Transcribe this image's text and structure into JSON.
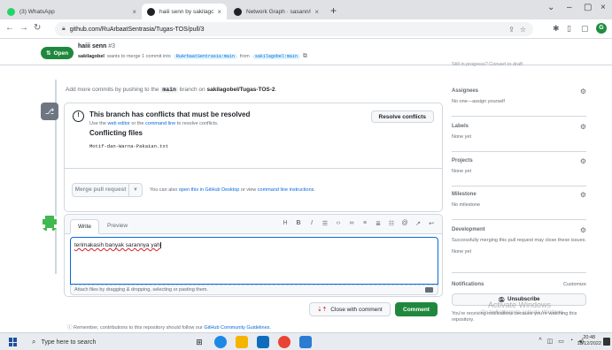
{
  "browser": {
    "tabs": [
      {
        "title": "(3) WhatsApp",
        "active": false,
        "icon_color": "#25d366"
      },
      {
        "title": "haiii senn by sakilagobel · Pull Re",
        "active": true,
        "icon_color": "#1f2328"
      },
      {
        "title": "Network Graph · sasann/Perubah",
        "active": false,
        "icon_color": "#1f2328"
      }
    ],
    "new_tab": "+",
    "url": "github.com/RuArbaatSentrasia/Tugas-TOS/pull/3",
    "profile_initial": "G"
  },
  "pr": {
    "state_label": "Open",
    "title": "haiii senn",
    "number": "#3",
    "author": "sakilagobel",
    "wants_text": "wants to merge 1 commit into",
    "base_branch": "RuArbaatSentrasia:main",
    "from_text": "from",
    "head_branch": "sakilagobel:main"
  },
  "timeline": {
    "add_commits_prefix": "Add more commits by pushing to the",
    "add_commits_branch": "main",
    "add_commits_mid": "branch on",
    "add_commits_repo": "sakilagobel/Tugas-TOS-2",
    "add_commits_suffix": "."
  },
  "merge": {
    "conflict_title": "This branch has conflicts that must be resolved",
    "conflict_desc_prefix": "Use the",
    "web_editor_link": "web editor",
    "conflict_desc_or": "or the",
    "command_line_link": "command line",
    "conflict_desc_suffix": "to resolve conflicts.",
    "conflicting_files_label": "Conflicting files",
    "conflicting_file": "Motif-dan-Warna-Pakaian.txt",
    "resolve_button": "Resolve conflicts",
    "merge_button": "Merge pull request",
    "merge_note_prefix": "You can also",
    "desktop_link": "open this in GitHub Desktop",
    "merge_note_mid": "or view",
    "instructions_link": "command line instructions",
    "merge_note_suffix": "."
  },
  "comment": {
    "tab_write": "Write",
    "tab_preview": "Preview",
    "toolbar": [
      "H",
      "B",
      "I",
      "quote",
      "code",
      "link",
      "bullets",
      "numbers",
      "tasks",
      "mention",
      "reference",
      "undo"
    ],
    "text": "terimakasih banyak sarannya yah",
    "attach_text": "Attach files by dragging & dropping, selecting or pasting them.",
    "close_button": "Close with comment",
    "comment_button": "Comment",
    "remember_prefix": "Remember, contributions to this repository should follow our",
    "guidelines_link": "GitHub Community Guidelines",
    "remember_suffix": "."
  },
  "sidebar": {
    "top_fade": "Still in progress? Convert to draft",
    "assignees": {
      "label": "Assignees",
      "value": "No one—assign yourself"
    },
    "labels": {
      "label": "Labels",
      "value": "None yet"
    },
    "projects": {
      "label": "Projects",
      "value": "None yet"
    },
    "milestone": {
      "label": "Milestone",
      "value": "No milestone"
    },
    "development": {
      "label": "Development",
      "value": "Successfully merging this pull request may close these issues.",
      "value2": "None yet"
    },
    "notifications": {
      "label": "Notifications",
      "customize": "Customize",
      "button": "Unsubscribe",
      "note": "You're receiving notifications because you're watching this repository."
    }
  },
  "watermark": {
    "line1": "Activate Windows",
    "line2": "Go to Settings to activate Windows."
  },
  "taskbar": {
    "search_placeholder": "Type here to search",
    "time": "20:48",
    "date": "18/12/2022"
  },
  "colors": {
    "open_green": "#1f883d",
    "link_blue": "#0969da",
    "danger_red": "#cf222e",
    "border": "#d0d7de"
  }
}
